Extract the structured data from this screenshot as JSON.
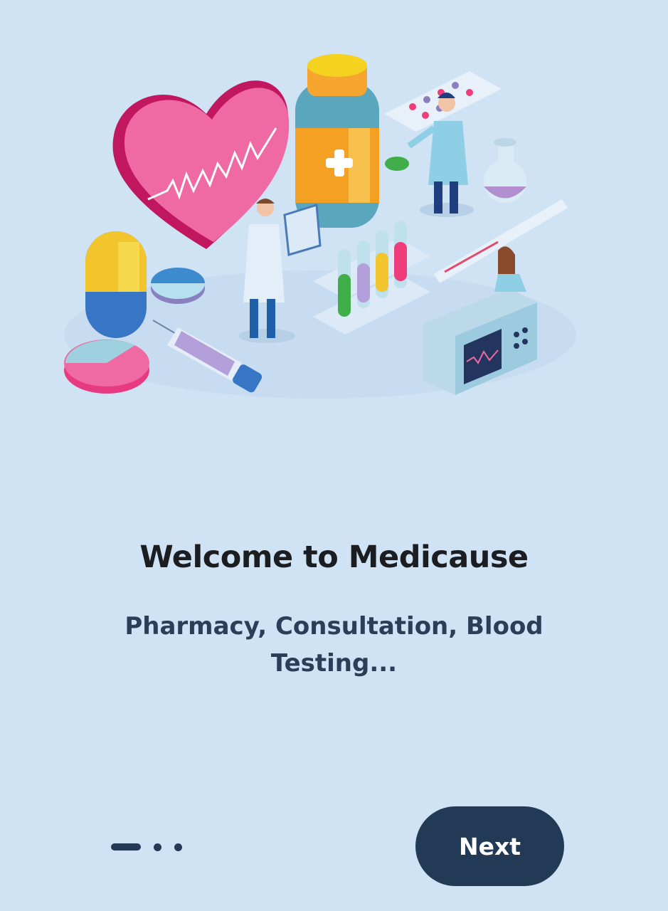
{
  "onboarding": {
    "title": "Welcome to Medicause",
    "subtitle": "Pharmacy, Consultation, Blood Testing...",
    "next_label": "Next",
    "page_index": 1,
    "page_count": 3
  },
  "colors": {
    "background": "#cfe3f4",
    "primary": "#233a57",
    "title": "#1b1d21",
    "subtitle": "#2c3e57",
    "heart": "#ef6aa3",
    "pill_yellow": "#f3c52c",
    "bottle_orange": "#f4a023"
  },
  "illustration": {
    "icon": "medical-isometric-illustration"
  }
}
